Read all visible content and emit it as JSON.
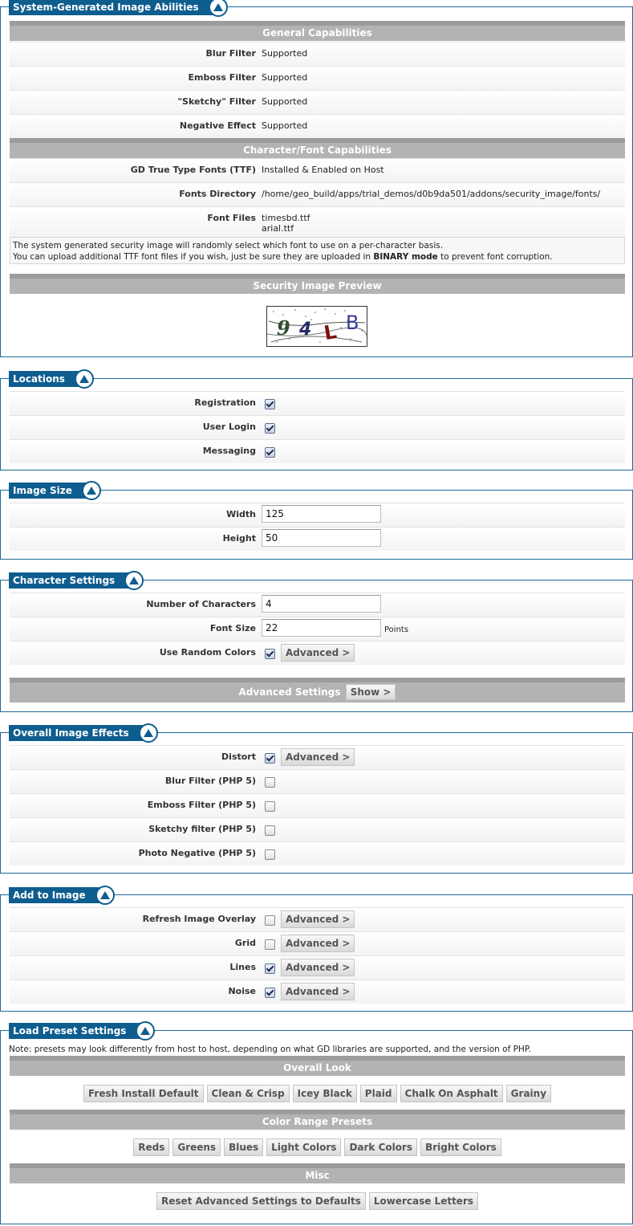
{
  "sections": {
    "system": {
      "title": "System-Generated Image Abilities",
      "general_header": "General Capabilities",
      "font_header": "Character/Font Capabilities",
      "preview_header": "Security Image Preview",
      "general_rows": [
        {
          "label": "Blur Filter",
          "value": "Supported"
        },
        {
          "label": "Emboss Filter",
          "value": "Supported"
        },
        {
          "label": "\"Sketchy\" Filter",
          "value": "Supported"
        },
        {
          "label": "Negative Effect",
          "value": "Supported"
        }
      ],
      "ttf_label": "GD True Type Fonts (TTF)",
      "ttf_value": "Installed & Enabled on Host",
      "dir_label": "Fonts Directory",
      "dir_value": "/home/geo_build/apps/trial_demos/d0b9da501/addons/security_image/fonts/",
      "files_label": "Font Files",
      "files": [
        "timesbd.ttf",
        "arial.ttf"
      ],
      "note_line1": "The system generated security image will randomly select which font to use on a per-character basis.",
      "note_line2_pre": "You can upload additional TTF font files if you wish, just be sure they are uploaded in ",
      "note_line2_bold": "BINARY mode",
      "note_line2_post": " to prevent font corruption.",
      "captcha_chars": [
        "9",
        "4",
        "L",
        "B"
      ]
    },
    "locations": {
      "title": "Locations",
      "rows": [
        {
          "label": "Registration",
          "checked": true
        },
        {
          "label": "User Login",
          "checked": true
        },
        {
          "label": "Messaging",
          "checked": true
        }
      ]
    },
    "image_size": {
      "title": "Image Size",
      "width_label": "Width",
      "width_value": "125",
      "height_label": "Height",
      "height_value": "50"
    },
    "character": {
      "title": "Character Settings",
      "num_label": "Number of Characters",
      "num_value": "4",
      "size_label": "Font Size",
      "size_value": "22",
      "size_units": "Points",
      "random_label": "Use Random Colors",
      "random_checked": true,
      "advanced_btn": "Advanced >",
      "adv_settings_label": "Advanced Settings",
      "show_btn": "Show >"
    },
    "effects": {
      "title": "Overall Image Effects",
      "advanced_btn": "Advanced >",
      "rows": [
        {
          "label": "Distort",
          "checked": true
        },
        {
          "label": "Blur Filter (PHP 5)",
          "checked": false
        },
        {
          "label": "Emboss Filter (PHP 5)",
          "checked": false
        },
        {
          "label": "Sketchy filter (PHP 5)",
          "checked": false
        },
        {
          "label": "Photo Negative (PHP 5)",
          "checked": false
        }
      ]
    },
    "add": {
      "title": "Add to Image",
      "advanced_btn": "Advanced >",
      "rows": [
        {
          "label": "Refresh Image Overlay",
          "checked": false
        },
        {
          "label": "Grid",
          "checked": false
        },
        {
          "label": "Lines",
          "checked": true
        },
        {
          "label": "Noise",
          "checked": true
        }
      ]
    },
    "presets": {
      "title": "Load Preset Settings",
      "note": "Note: presets may look differently from host to host, depending on what GD libraries are supported, and the version of PHP.",
      "overall_header": "Overall Look",
      "overall": [
        "Fresh Install Default",
        "Clean & Crisp",
        "Icey Black",
        "Plaid",
        "Chalk On Asphalt",
        "Grainy"
      ],
      "color_header": "Color Range Presets",
      "colors": [
        "Reds",
        "Greens",
        "Blues",
        "Light Colors",
        "Dark Colors",
        "Bright Colors"
      ],
      "misc_header": "Misc",
      "misc": [
        "Reset Advanced Settings to Defaults",
        "Lowercase Letters"
      ]
    }
  },
  "colors": {
    "legend_bg": "#0e5d8f",
    "bar_bg": "#b3b3b3",
    "border": "#1e6896"
  }
}
